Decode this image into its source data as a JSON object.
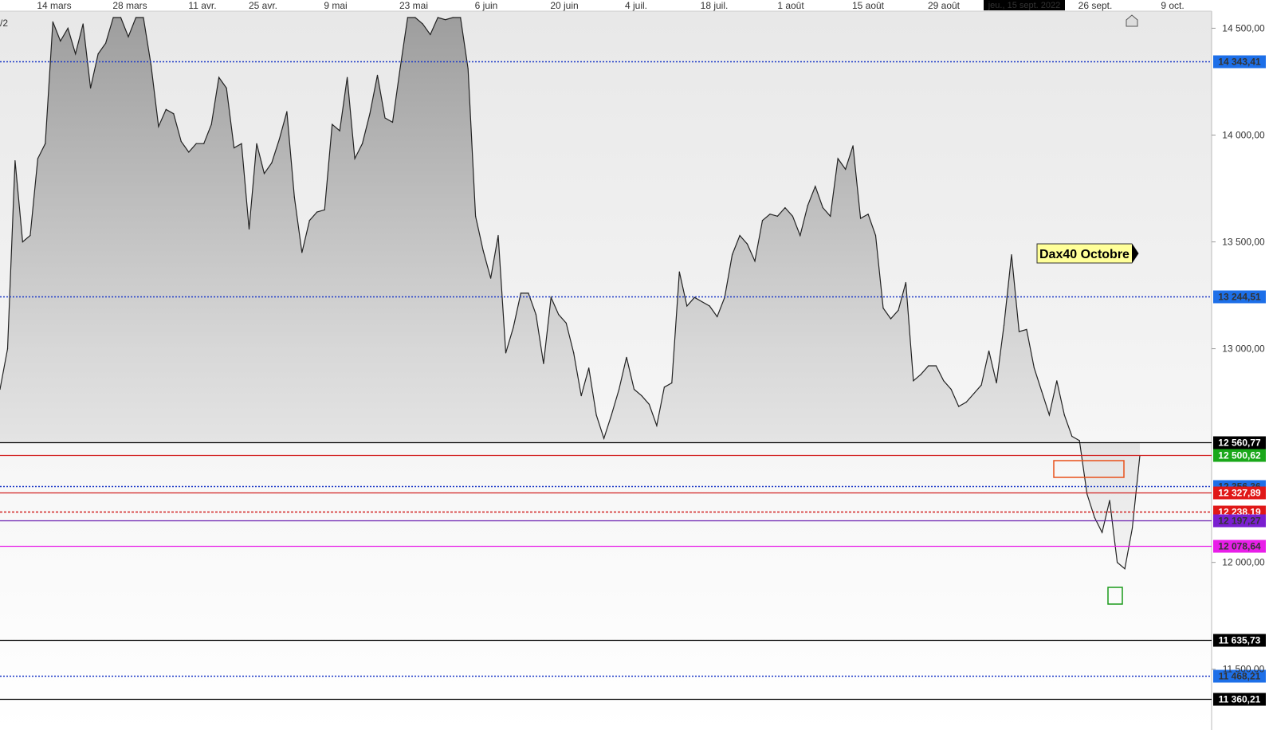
{
  "chart_data": {
    "type": "area",
    "title": "",
    "xlabel": "",
    "ylabel": "",
    "ylim": [
      11320,
      14550
    ],
    "grid": false,
    "x_ticks": [
      "14 mars",
      "28 mars",
      "11 avr.",
      "25 avr.",
      "9 mai",
      "23 mai",
      "6 juin",
      "20 juin",
      "4 juil.",
      "18 juil.",
      "1 août",
      "15 août",
      "29 août",
      "26 sept.",
      "9 oct."
    ],
    "y_ticks": [
      {
        "value": 14500,
        "label": "14 500,00"
      },
      {
        "value": 14000,
        "label": "14 000,00"
      },
      {
        "value": 13500,
        "label": "13 500,00"
      },
      {
        "value": 13000,
        "label": "13 000,00"
      },
      {
        "value": 12000,
        "label": "12 000,00"
      },
      {
        "value": 11500,
        "label": "11 500,00"
      }
    ],
    "crosshair_date": "jeu., 15 sept. 2022",
    "top_left_label": "/2",
    "annotation": "Dax40 Octobre",
    "series": [
      {
        "values": [
          12810,
          13000,
          13880,
          13500,
          13530,
          13890,
          13960,
          14530,
          14440,
          14500,
          14380,
          14520,
          14220,
          14380,
          14430,
          14550,
          14550,
          14460,
          14550,
          14550,
          14330,
          14040,
          14120,
          14100,
          13970,
          13920,
          13960,
          13960,
          14050,
          14270,
          14220,
          13940,
          13960,
          13560,
          13960,
          13820,
          13870,
          13980,
          14110,
          13710,
          13450,
          13600,
          13640,
          13650,
          14050,
          14020,
          14270,
          13890,
          13960,
          14100,
          14280,
          14080,
          14060,
          14310,
          14550,
          14550,
          14520,
          14470,
          14550,
          14540,
          14550,
          14550,
          14310,
          13620,
          13460,
          13330,
          13530,
          12980,
          13100,
          13260,
          13260,
          13160,
          12930,
          13240,
          13160,
          13120,
          12980,
          12780,
          12910,
          12690,
          12580,
          12690,
          12810,
          12960,
          12810,
          12780,
          12740,
          12640,
          12820,
          12840,
          13360,
          13200,
          13240,
          13220,
          13200,
          13150,
          13240,
          13440,
          13530,
          13490,
          13410,
          13600,
          13630,
          13620,
          13660,
          13620,
          13530,
          13670,
          13760,
          13660,
          13620,
          13890,
          13840,
          13950,
          13610,
          13630,
          13530,
          13190,
          13140,
          13180,
          13310,
          12850,
          12880,
          12920,
          12920,
          12850,
          12810,
          12730,
          12750,
          12790,
          12830,
          12990,
          12840,
          13110,
          13440,
          13080,
          13090,
          12910,
          12800,
          12690,
          12850,
          12690,
          12590,
          12570,
          12320,
          12210,
          12140,
          12290,
          12000,
          11970,
          12160,
          12500
        ]
      }
    ],
    "horizontal_levels": [
      {
        "value": 14343.41,
        "label": "14 343,41",
        "style": "dotted",
        "line_color": "#1c39c7",
        "tag_color": "#1d6fe8",
        "text_color": "#333333"
      },
      {
        "value": 13244.51,
        "label": "13 244,51",
        "style": "dotted",
        "line_color": "#1c39c7",
        "tag_color": "#1d6fe8",
        "text_color": "#333333"
      },
      {
        "value": 12560.77,
        "label": "12 560,77",
        "style": "solid",
        "line_color": "#000000",
        "tag_color": "#000000",
        "text_color": "#ffffff"
      },
      {
        "value": 12500.62,
        "label": "12 500,62",
        "style": "solid",
        "line_color": "#d22020",
        "tag_color": "#1aa81a",
        "text_color": "#ffffff"
      },
      {
        "value": 12356.36,
        "label": "12 356,36",
        "style": "dotted",
        "line_color": "#1c39c7",
        "tag_color": "#1d6fe8",
        "text_color": "#333333"
      },
      {
        "value": 12327.89,
        "label": "12 327,89",
        "style": "solid",
        "line_color": "#d22020",
        "tag_color": "#e01818",
        "text_color": "#ffffff"
      },
      {
        "value": 12238.19,
        "label": "12 238,19",
        "style": "dashed",
        "line_color": "#d22020",
        "tag_color": "#e01818",
        "text_color": "#ffffff"
      },
      {
        "value": 12197.27,
        "label": "12 197,27",
        "style": "solid",
        "line_color": "#6a1fb0",
        "tag_color": "#7a1fd0",
        "text_color": "#333333"
      },
      {
        "value": 12078.64,
        "label": "12 078,64",
        "style": "solid",
        "line_color": "#e81ee8",
        "tag_color": "#e81ee8",
        "text_color": "#333333"
      },
      {
        "value": 11635.73,
        "label": "11 635,73",
        "style": "solid",
        "line_color": "#000000",
        "tag_color": "#000000",
        "text_color": "#ffffff"
      },
      {
        "value": 11468.21,
        "label": "11 468,21",
        "style": "dotted",
        "line_color": "#1c39c7",
        "tag_color": "#1d6fe8",
        "text_color": "#333333"
      },
      {
        "value": 11360.21,
        "label": "11 360,21",
        "style": "solid",
        "line_color": "#000000",
        "tag_color": "#000000",
        "text_color": "#ffffff"
      }
    ]
  }
}
